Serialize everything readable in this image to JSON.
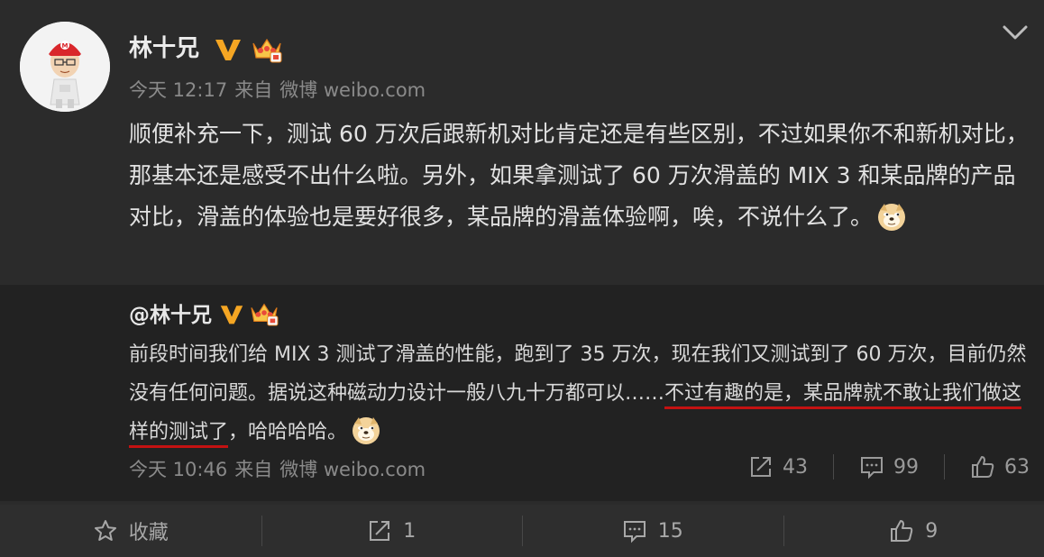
{
  "post": {
    "author": "林十兄",
    "time": "今天 12:17",
    "source_prefix": "来自",
    "source": "微博 weibo.com",
    "text": "顺便补充一下，测试 60 万次后跟新机对比肯定还是有些区别，不过如果你不和新机对比，那基本还是感受不出什么啦。另外，如果拿测试了 60 万次滑盖的 MIX 3 和某品牌的产品对比，滑盖的体验也是要好很多，某品牌的滑盖体验啊，唉，不说什么了。"
  },
  "repost": {
    "author": "@林十兄",
    "text_before": "前段时间我们给 MIX 3 测试了滑盖的性能，跑到了 35 万次，现在我们又测试到了 60 万次，目前仍然没有任何问题。据说这种磁动力设计一般八九十万都可以……",
    "text_highlight": "不过有趣的是，某品牌就不敢让我们做这样的测试了",
    "text_after": "，哈哈哈哈。",
    "time": "今天 10:46",
    "source_prefix": "来自",
    "source": "微博 weibo.com",
    "stats": {
      "reposts": "43",
      "comments": "99",
      "likes": "63"
    }
  },
  "footer": {
    "favorite_label": "收藏",
    "repost_count": "1",
    "comment_count": "15",
    "like_count": "9"
  },
  "colors": {
    "background": "#2b2b2b",
    "repost_background": "#222222",
    "verified_badge": "#f5a623",
    "highlight_underline": "#c41212"
  },
  "icons": {
    "verified": "verified-v-icon",
    "member": "crown-member-icon",
    "expand": "chevron-down-icon",
    "emoji": "doge-emoji-icon",
    "repost": "share-icon",
    "comment": "comment-icon",
    "like": "thumbs-up-icon",
    "favorite": "star-icon"
  }
}
